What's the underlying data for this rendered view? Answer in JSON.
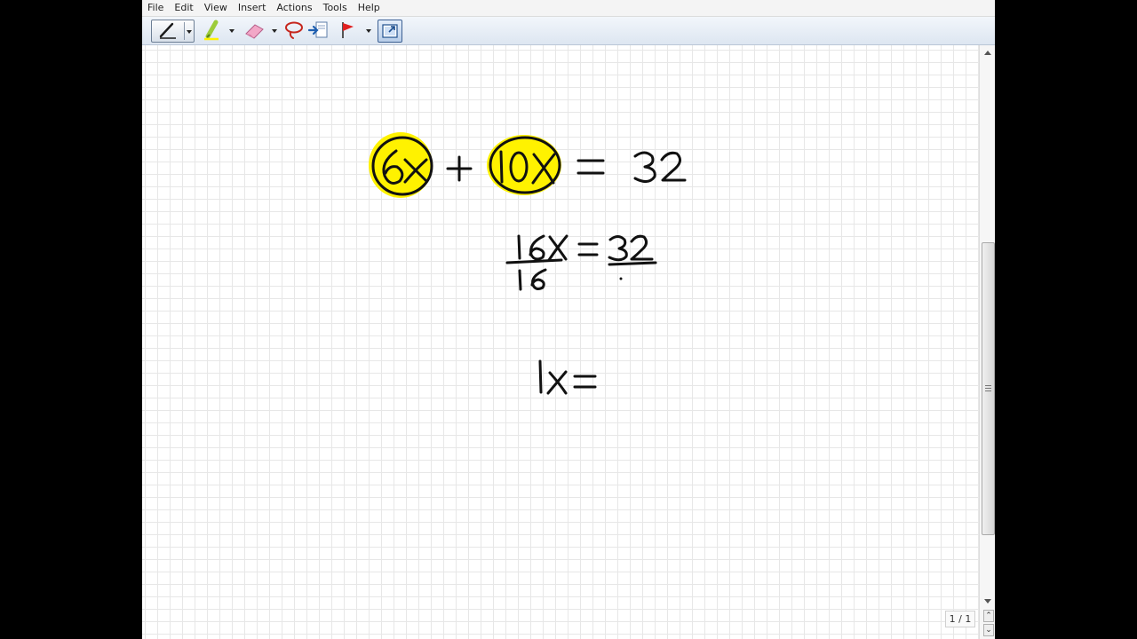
{
  "menu": {
    "items": [
      "File",
      "Edit",
      "View",
      "Insert",
      "Actions",
      "Tools",
      "Help"
    ]
  },
  "toolbar": {
    "tools": [
      {
        "name": "pen-tool",
        "icon": "pen-icon"
      },
      {
        "name": "highlighter-tool",
        "icon": "highlighter-icon"
      },
      {
        "name": "eraser-tool",
        "icon": "eraser-icon"
      },
      {
        "name": "lasso-tool",
        "icon": "lasso-icon"
      },
      {
        "name": "insert-space-tool",
        "icon": "insert-space-icon"
      },
      {
        "name": "flag-tool",
        "icon": "flag-icon"
      },
      {
        "name": "selection-tool",
        "icon": "selection-icon"
      }
    ]
  },
  "canvas": {
    "highlight_color": "#fff200",
    "ink_color": "#111111",
    "grid_color": "#e7e7e7",
    "equations": [
      "6x + 10x = 32",
      "16x/16 = 32/",
      "1x ="
    ]
  },
  "page_indicator": "1 / 1"
}
